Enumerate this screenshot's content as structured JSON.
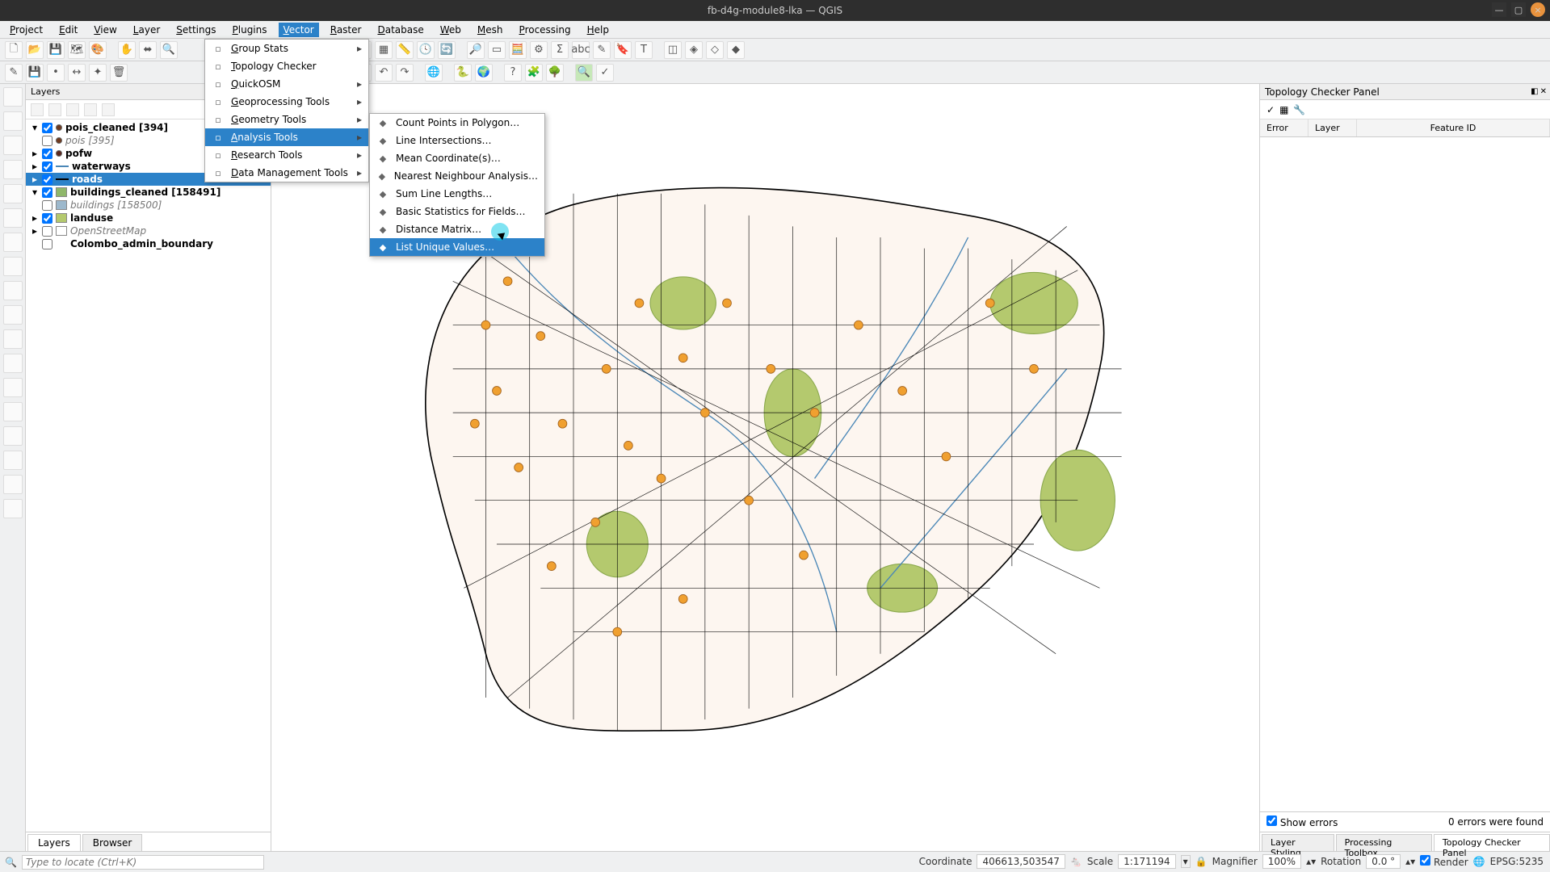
{
  "title": "fb-d4g-module8-lka — QGIS",
  "menu": [
    "Project",
    "Edit",
    "View",
    "Layer",
    "Settings",
    "Plugins",
    "Vector",
    "Raster",
    "Database",
    "Web",
    "Mesh",
    "Processing",
    "Help"
  ],
  "active_menu": 6,
  "vector_menu": [
    {
      "label": "Group Stats",
      "sub": true
    },
    {
      "label": "Topology Checker",
      "sub": false
    },
    {
      "label": "QuickOSM",
      "sub": true
    },
    {
      "label": "Geoprocessing Tools",
      "sub": true
    },
    {
      "label": "Geometry Tools",
      "sub": true
    },
    {
      "label": "Analysis Tools",
      "sub": true,
      "sel": true
    },
    {
      "label": "Research Tools",
      "sub": true
    },
    {
      "label": "Data Management Tools",
      "sub": true
    }
  ],
  "analysis_menu": [
    "Count Points in Polygon…",
    "Line Intersections…",
    "Mean Coordinate(s)…",
    "Nearest Neighbour Analysis…",
    "Sum Line Lengths…",
    "Basic Statistics for Fields…",
    "Distance Matrix…",
    "List Unique Values…"
  ],
  "analysis_sel": 7,
  "layers_title": "Layers",
  "layers": [
    {
      "exp": "▾",
      "chk": true,
      "sym": {
        "type": "dot",
        "color": "#6f3a1f"
      },
      "name": "pois_cleaned [394]",
      "bold": true
    },
    {
      "exp": "",
      "chk": false,
      "sym": {
        "type": "dot",
        "color": "#6f3a1f"
      },
      "name": "pois [395]",
      "italic": true
    },
    {
      "exp": "▸",
      "chk": true,
      "sym": {
        "type": "dot",
        "color": "#5c281e"
      },
      "name": "pofw",
      "bold": true
    },
    {
      "exp": "▸",
      "chk": true,
      "sym": {
        "type": "line",
        "color": "#4a87b7"
      },
      "name": "waterways",
      "bold": true
    },
    {
      "exp": "▸",
      "chk": true,
      "sym": {
        "type": "line",
        "color": "#000"
      },
      "name": "roads",
      "bold": true,
      "sel": true
    },
    {
      "exp": "▾",
      "chk": true,
      "sym": {
        "type": "swatch",
        "color": "#8fb76a"
      },
      "name": "buildings_cleaned [158491]",
      "bold": true
    },
    {
      "exp": "",
      "chk": false,
      "sym": {
        "type": "swatch",
        "color": "#9cb8cc"
      },
      "name": "buildings [158500]",
      "italic": true
    },
    {
      "exp": "▸",
      "chk": true,
      "sym": {
        "type": "swatch",
        "color": "#b4c96e"
      },
      "name": "landuse",
      "bold": true
    },
    {
      "exp": "▸",
      "chk": false,
      "sym": {
        "type": "swatch",
        "color": "#fff"
      },
      "name": "OpenStreetMap",
      "italic": true
    },
    {
      "exp": "",
      "chk": false,
      "sym": {
        "type": "none"
      },
      "name": "Colombo_admin_boundary",
      "bold": true
    }
  ],
  "layer_tabs": [
    "Layers",
    "Browser"
  ],
  "right": {
    "title": "Topology Checker Panel",
    "cols": [
      "Error",
      "Layer",
      "Feature ID"
    ],
    "show_errors": "Show errors",
    "err_count": "0 errors were found",
    "tabs": [
      "Layer Styling",
      "Processing Toolbox",
      "Topology Checker Panel"
    ]
  },
  "locator_placeholder": "Type to locate (Ctrl+K)",
  "status": {
    "coord_label": "Coordinate",
    "coord": "406613,503547",
    "scale_label": "Scale",
    "scale": "1:171194",
    "mag_label": "Magnifier",
    "mag": "100%",
    "rot_label": "Rotation",
    "rot": "0.0 °",
    "render": "Render",
    "crs": "EPSG:5235"
  }
}
